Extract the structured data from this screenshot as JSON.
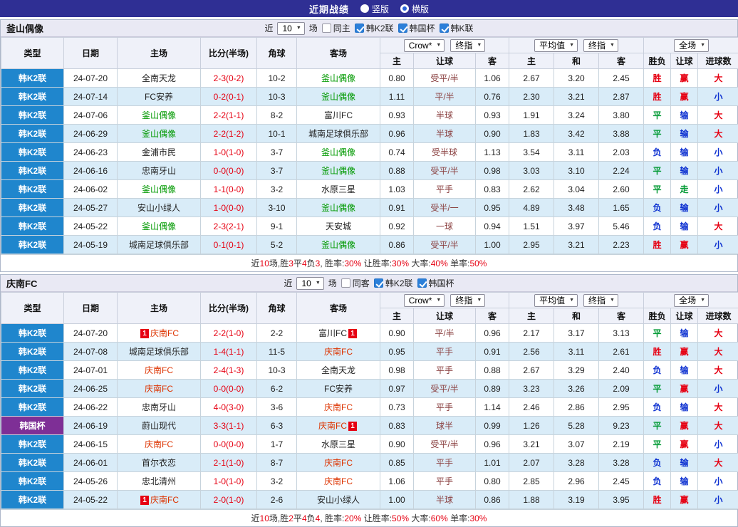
{
  "topbar": {
    "title": "近期战绩",
    "options": [
      {
        "label": "竖版",
        "selected": false
      },
      {
        "label": "横版",
        "selected": true
      }
    ]
  },
  "labels": {
    "recent": "近",
    "games": "场"
  },
  "table_header": {
    "type": "类型",
    "date": "日期",
    "home": "主场",
    "score": "比分(半场)",
    "corner": "角球",
    "away": "客场",
    "bookmaker": "Crow*",
    "stage1": "终指",
    "average": "平均值",
    "stage2": "终指",
    "scope": "全场",
    "sub": [
      "主",
      "让球",
      "客",
      "主",
      "和",
      "客",
      "胜负",
      "让球",
      "进球数"
    ]
  },
  "league_colors": {
    "韩K2联": "#1f86cd",
    "韩国杯": "#7e2f96"
  },
  "result_colors": {
    "胜": "#e60012",
    "平": "#009933",
    "负": "#0b2fd0",
    "赢": "#e60012",
    "输": "#0b2fd0",
    "走": "#009933",
    "大": "#e60012",
    "小": "#0b2fd0"
  },
  "sections": [
    {
      "team": "釜山偶像",
      "focal_color": "#009900",
      "filter": {
        "count": "10",
        "same_label": "同主",
        "leagues": [
          {
            "label": "韩K2联",
            "checked": true
          },
          {
            "label": "韩国杯",
            "checked": true
          },
          {
            "label": "韩K联",
            "checked": true
          }
        ]
      },
      "rows": [
        {
          "league": "韩K2联",
          "date": "24-07-20",
          "home": "全南天龙",
          "home_focal": false,
          "score": "2-3(0-2)",
          "corner": "10-2",
          "away": "釜山偶像",
          "away_focal": true,
          "odds": [
            "0.80",
            "受平/半",
            "1.06"
          ],
          "avg": [
            "2.67",
            "3.20",
            "2.45"
          ],
          "results": [
            "胜",
            "赢",
            "大"
          ]
        },
        {
          "league": "韩K2联",
          "date": "24-07-14",
          "home": "FC安养",
          "home_focal": false,
          "score": "0-2(0-1)",
          "corner": "10-3",
          "away": "釜山偶像",
          "away_focal": true,
          "odds": [
            "1.11",
            "平/半",
            "0.76"
          ],
          "avg": [
            "2.30",
            "3.21",
            "2.87"
          ],
          "results": [
            "胜",
            "赢",
            "小"
          ]
        },
        {
          "league": "韩K2联",
          "date": "24-07-06",
          "home": "釜山偶像",
          "home_focal": true,
          "score": "2-2(1-1)",
          "corner": "8-2",
          "away": "富川FC",
          "away_focal": false,
          "odds": [
            "0.93",
            "半球",
            "0.93"
          ],
          "avg": [
            "1.91",
            "3.24",
            "3.80"
          ],
          "results": [
            "平",
            "输",
            "大"
          ]
        },
        {
          "league": "韩K2联",
          "date": "24-06-29",
          "home": "釜山偶像",
          "home_focal": true,
          "score": "2-2(1-2)",
          "corner": "10-1",
          "away": "城南足球俱乐部",
          "away_focal": false,
          "odds": [
            "0.96",
            "半球",
            "0.90"
          ],
          "avg": [
            "1.83",
            "3.42",
            "3.88"
          ],
          "results": [
            "平",
            "输",
            "大"
          ]
        },
        {
          "league": "韩K2联",
          "date": "24-06-23",
          "home": "金浦市民",
          "home_focal": false,
          "score": "1-0(1-0)",
          "corner": "3-7",
          "away": "釜山偶像",
          "away_focal": true,
          "odds": [
            "0.74",
            "受半球",
            "1.13"
          ],
          "avg": [
            "3.54",
            "3.11",
            "2.03"
          ],
          "results": [
            "负",
            "输",
            "小"
          ]
        },
        {
          "league": "韩K2联",
          "date": "24-06-16",
          "home": "忠南牙山",
          "home_focal": false,
          "score": "0-0(0-0)",
          "corner": "3-7",
          "away": "釜山偶像",
          "away_focal": true,
          "odds": [
            "0.88",
            "受平/半",
            "0.98"
          ],
          "avg": [
            "3.03",
            "3.10",
            "2.24"
          ],
          "results": [
            "平",
            "输",
            "小"
          ]
        },
        {
          "league": "韩K2联",
          "date": "24-06-02",
          "home": "釜山偶像",
          "home_focal": true,
          "score": "1-1(0-0)",
          "corner": "3-2",
          "away": "水原三星",
          "away_focal": false,
          "odds": [
            "1.03",
            "平手",
            "0.83"
          ],
          "avg": [
            "2.62",
            "3.04",
            "2.60"
          ],
          "results": [
            "平",
            "走",
            "小"
          ]
        },
        {
          "league": "韩K2联",
          "date": "24-05-27",
          "home": "安山小绿人",
          "home_focal": false,
          "score": "1-0(0-0)",
          "corner": "3-10",
          "away": "釜山偶像",
          "away_focal": true,
          "odds": [
            "0.91",
            "受半/一",
            "0.95"
          ],
          "avg": [
            "4.89",
            "3.48",
            "1.65"
          ],
          "results": [
            "负",
            "输",
            "小"
          ]
        },
        {
          "league": "韩K2联",
          "date": "24-05-22",
          "home": "釜山偶像",
          "home_focal": true,
          "score": "2-3(2-1)",
          "corner": "9-1",
          "away": "天安城",
          "away_focal": false,
          "odds": [
            "0.92",
            "一球",
            "0.94"
          ],
          "avg": [
            "1.51",
            "3.97",
            "5.46"
          ],
          "results": [
            "负",
            "输",
            "大"
          ]
        },
        {
          "league": "韩K2联",
          "date": "24-05-19",
          "home": "城南足球俱乐部",
          "home_focal": false,
          "score": "0-1(0-1)",
          "corner": "5-2",
          "away": "釜山偶像",
          "away_focal": true,
          "odds": [
            "0.86",
            "受平/半",
            "1.00"
          ],
          "avg": [
            "2.95",
            "3.21",
            "2.23"
          ],
          "results": [
            "胜",
            "赢",
            "小"
          ]
        }
      ],
      "summary": [
        {
          "t": "近"
        },
        {
          "t": "10",
          "r": true
        },
        {
          "t": "场,胜"
        },
        {
          "t": "3",
          "r": true
        },
        {
          "t": "平"
        },
        {
          "t": "4",
          "r": true
        },
        {
          "t": "负"
        },
        {
          "t": "3",
          "r": true
        },
        {
          "t": ", 胜率:"
        },
        {
          "t": "30%",
          "r": true
        },
        {
          "t": " 让胜率:"
        },
        {
          "t": "30%",
          "r": true
        },
        {
          "t": " 大率:"
        },
        {
          "t": "40%",
          "r": true
        },
        {
          "t": " 单率:"
        },
        {
          "t": "50%",
          "r": true
        }
      ]
    },
    {
      "team": "庆南FC",
      "focal_color": "#dd3300",
      "filter": {
        "count": "10",
        "same_label": "同客",
        "leagues": [
          {
            "label": "韩K2联",
            "checked": true
          },
          {
            "label": "韩国杯",
            "checked": true
          }
        ]
      },
      "rows": [
        {
          "league": "韩K2联",
          "date": "24-07-20",
          "home": "庆南FC",
          "home_focal": true,
          "home_badge_pre": "1",
          "score": "2-2(1-0)",
          "corner": "2-2",
          "away": "富川FC",
          "away_focal": false,
          "away_badge_post": "1",
          "odds": [
            "0.90",
            "平/半",
            "0.96"
          ],
          "avg": [
            "2.17",
            "3.17",
            "3.13"
          ],
          "results": [
            "平",
            "输",
            "大"
          ]
        },
        {
          "league": "韩K2联",
          "date": "24-07-08",
          "home": "城南足球俱乐部",
          "home_focal": false,
          "score": "1-4(1-1)",
          "corner": "11-5",
          "away": "庆南FC",
          "away_focal": true,
          "odds": [
            "0.95",
            "平手",
            "0.91"
          ],
          "avg": [
            "2.56",
            "3.11",
            "2.61"
          ],
          "results": [
            "胜",
            "赢",
            "大"
          ]
        },
        {
          "league": "韩K2联",
          "date": "24-07-01",
          "home": "庆南FC",
          "home_focal": true,
          "score": "2-4(1-3)",
          "corner": "10-3",
          "away": "全南天龙",
          "away_focal": false,
          "odds": [
            "0.98",
            "平手",
            "0.88"
          ],
          "avg": [
            "2.67",
            "3.29",
            "2.40"
          ],
          "results": [
            "负",
            "输",
            "大"
          ]
        },
        {
          "league": "韩K2联",
          "date": "24-06-25",
          "home": "庆南FC",
          "home_focal": true,
          "score": "0-0(0-0)",
          "corner": "6-2",
          "away": "FC安养",
          "away_focal": false,
          "odds": [
            "0.97",
            "受平/半",
            "0.89"
          ],
          "avg": [
            "3.23",
            "3.26",
            "2.09"
          ],
          "results": [
            "平",
            "赢",
            "小"
          ]
        },
        {
          "league": "韩K2联",
          "date": "24-06-22",
          "home": "忠南牙山",
          "home_focal": false,
          "score": "4-0(3-0)",
          "corner": "3-6",
          "away": "庆南FC",
          "away_focal": true,
          "odds": [
            "0.73",
            "平手",
            "1.14"
          ],
          "avg": [
            "2.46",
            "2.86",
            "2.95"
          ],
          "results": [
            "负",
            "输",
            "大"
          ]
        },
        {
          "league": "韩国杯",
          "date": "24-06-19",
          "home": "蔚山现代",
          "home_focal": false,
          "score": "3-3(1-1)",
          "corner": "6-3",
          "away": "庆南FC",
          "away_focal": true,
          "away_badge_post": "1",
          "odds": [
            "0.83",
            "球半",
            "0.99"
          ],
          "avg": [
            "1.26",
            "5.28",
            "9.23"
          ],
          "results": [
            "平",
            "赢",
            "大"
          ]
        },
        {
          "league": "韩K2联",
          "date": "24-06-15",
          "home": "庆南FC",
          "home_focal": true,
          "score": "0-0(0-0)",
          "corner": "1-7",
          "away": "水原三星",
          "away_focal": false,
          "odds": [
            "0.90",
            "受平/半",
            "0.96"
          ],
          "avg": [
            "3.21",
            "3.07",
            "2.19"
          ],
          "results": [
            "平",
            "赢",
            "小"
          ]
        },
        {
          "league": "韩K2联",
          "date": "24-06-01",
          "home": "首尔衣恋",
          "home_focal": false,
          "score": "2-1(1-0)",
          "corner": "8-7",
          "away": "庆南FC",
          "away_focal": true,
          "odds": [
            "0.85",
            "平手",
            "1.01"
          ],
          "avg": [
            "2.07",
            "3.28",
            "3.28"
          ],
          "results": [
            "负",
            "输",
            "大"
          ]
        },
        {
          "league": "韩K2联",
          "date": "24-05-26",
          "home": "忠北清州",
          "home_focal": false,
          "score": "1-0(1-0)",
          "corner": "3-2",
          "away": "庆南FC",
          "away_focal": true,
          "odds": [
            "1.06",
            "平手",
            "0.80"
          ],
          "avg": [
            "2.85",
            "2.96",
            "2.45"
          ],
          "results": [
            "负",
            "输",
            "小"
          ]
        },
        {
          "league": "韩K2联",
          "date": "24-05-22",
          "home": "庆南FC",
          "home_focal": true,
          "home_badge_pre": "1",
          "score": "2-0(1-0)",
          "corner": "2-6",
          "away": "安山小绿人",
          "away_focal": false,
          "odds": [
            "1.00",
            "半球",
            "0.86"
          ],
          "avg": [
            "1.88",
            "3.19",
            "3.95"
          ],
          "results": [
            "胜",
            "赢",
            "小"
          ]
        }
      ],
      "summary": [
        {
          "t": "近"
        },
        {
          "t": "10",
          "r": true
        },
        {
          "t": "场,胜"
        },
        {
          "t": "2",
          "r": true
        },
        {
          "t": "平"
        },
        {
          "t": "4",
          "r": true
        },
        {
          "t": "负"
        },
        {
          "t": "4",
          "r": true
        },
        {
          "t": ", 胜率:"
        },
        {
          "t": "20%",
          "r": true
        },
        {
          "t": " 让胜率:"
        },
        {
          "t": "50%",
          "r": true
        },
        {
          "t": " 大率:"
        },
        {
          "t": "60%",
          "r": true
        },
        {
          "t": " 单率:"
        },
        {
          "t": "30%",
          "r": true
        }
      ]
    }
  ]
}
